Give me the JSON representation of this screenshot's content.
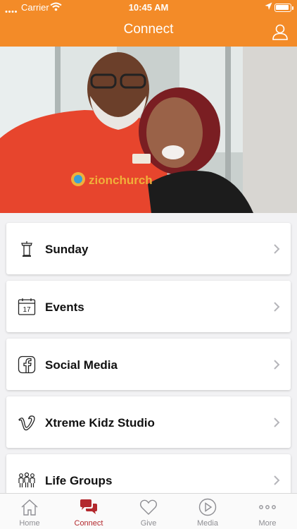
{
  "status_bar": {
    "carrier": "Carrier",
    "time": "10:45 AM"
  },
  "nav": {
    "title": "Connect",
    "profile_icon": "person-outline-icon"
  },
  "hero": {
    "logo_text": "zionchurch"
  },
  "menu": [
    {
      "label": "Sunday",
      "icon": "podium-icon"
    },
    {
      "label": "Events",
      "icon": "calendar-icon",
      "icon_text": "17"
    },
    {
      "label": "Social Media",
      "icon": "facebook-icon"
    },
    {
      "label": "Xtreme Kidz Studio",
      "icon": "vimeo-icon"
    },
    {
      "label": "Life Groups",
      "icon": "people-group-icon"
    }
  ],
  "tabs": [
    {
      "label": "Home",
      "icon": "home-icon",
      "active": false
    },
    {
      "label": "Connect",
      "icon": "chat-bubbles-icon",
      "active": true
    },
    {
      "label": "Give",
      "icon": "heart-icon",
      "active": false
    },
    {
      "label": "Media",
      "icon": "play-circle-icon",
      "active": false
    },
    {
      "label": "More",
      "icon": "more-dots-icon",
      "active": false
    }
  ],
  "colors": {
    "header": "#f38b28",
    "active_tab": "#b3282d",
    "inactive_tab": "#8e8e93"
  }
}
